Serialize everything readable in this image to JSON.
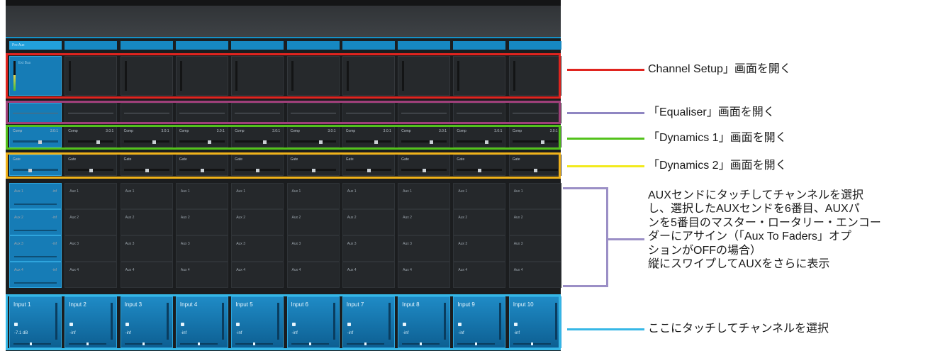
{
  "channels": [
    {
      "name": "Input 1",
      "value": "-7.1 dB",
      "header": "Pre Aux",
      "comp_ratio": "3.0:1"
    },
    {
      "name": "Input 2",
      "value": "-inf",
      "header": "",
      "comp_ratio": "3.0:1"
    },
    {
      "name": "Input 3",
      "value": "-inf",
      "header": "",
      "comp_ratio": "3.0:1"
    },
    {
      "name": "Input 4",
      "value": "-inf",
      "header": "",
      "comp_ratio": "3.0:1"
    },
    {
      "name": "Input 5",
      "value": "-inf",
      "header": "",
      "comp_ratio": "3.0:1"
    },
    {
      "name": "Input 6",
      "value": "-inf",
      "header": "",
      "comp_ratio": "3.0:1"
    },
    {
      "name": "Input 7",
      "value": "-inf",
      "header": "",
      "comp_ratio": "3.0:1"
    },
    {
      "name": "Input 8",
      "value": "-inf",
      "header": "",
      "comp_ratio": "3.0:1"
    },
    {
      "name": "Input 9",
      "value": "-inf",
      "header": "",
      "comp_ratio": "3.0:1"
    },
    {
      "name": "Input 10",
      "value": "-inf",
      "header": "",
      "comp_ratio": "3.0:1"
    }
  ],
  "strip_labels": {
    "channel_setup": "Ext Bus",
    "dyn1": "Comp",
    "dyn2": "Gate",
    "aux": [
      "Aux 1",
      "Aux 2",
      "Aux 3",
      "Aux 4"
    ],
    "aux_value": "-inf"
  },
  "callouts": {
    "channel_setup": "Channel Setup」画面を開く",
    "equaliser": "「Equaliser」画面を開く",
    "dynamics1": "「Dynamics 1」画面を開く",
    "dynamics2": "「Dynamics 2」画面を開く",
    "aux_lines": [
      "AUXセンドにタッチしてチャンネルを選択",
      "し、選択したAUXセンドを6番目、AUXパ",
      "ンを5番目のマスター・ロータリー・エンコー",
      "ダーにアサイン（「Aux To Faders」オプ",
      "ションがOFFの場合）",
      "縦にスワイプしてAUXをさらに表示"
    ],
    "input": "ここにタッチしてチャンネルを選択"
  },
  "colors": {
    "channel_setup": "#e0241f",
    "equaliser": "#a0407a",
    "dynamics1": "#53c21b",
    "dynamics2": "#f0b21a",
    "aux": "#9b8fc6",
    "input": "#36b7e6",
    "equaliser_line": "#8f86c2",
    "dynamics2_line": "#f2ea1d"
  }
}
